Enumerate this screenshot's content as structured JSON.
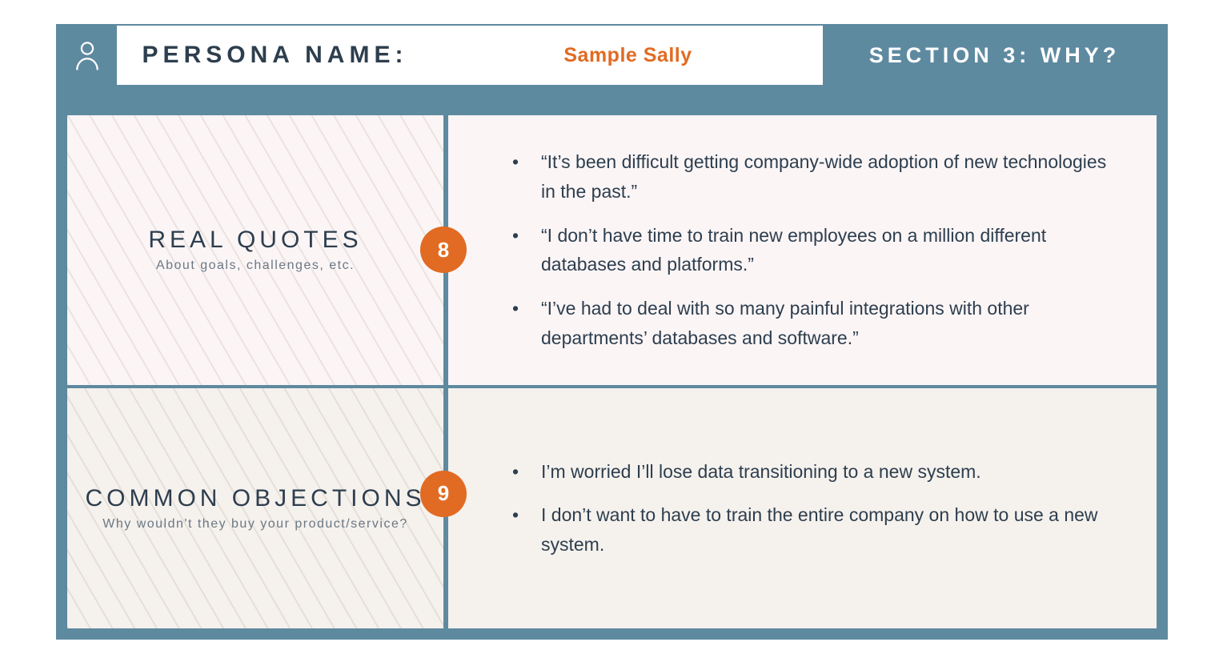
{
  "header": {
    "label": "PERSONA NAME:",
    "value": "Sample Sally",
    "section": "SECTION 3: WHY?"
  },
  "rows": [
    {
      "badge": "8",
      "title": "REAL QUOTES",
      "subtitle": "About goals, challenges, etc.",
      "bullets": [
        "“It’s been difficult getting company-wide adoption of new technologies in the past.”",
        "“I don’t have time to train new employees on a million different databases and platforms.”",
        "“I’ve had to deal with so many painful integrations with other departments’ databases and software.”"
      ]
    },
    {
      "badge": "9",
      "title": "COMMON OBJECTIONS",
      "subtitle": "Why wouldn't they buy your product/service?",
      "bullets": [
        "I’m worried I’ll lose data transitioning to a new system.",
        "I don’t want to have to train the entire company on how to use a new system."
      ]
    }
  ]
}
